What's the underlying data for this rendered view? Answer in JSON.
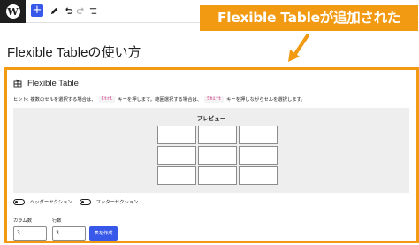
{
  "toolbar": {
    "logo_glyph": "W",
    "add_label": "+",
    "icons": [
      "pen-icon",
      "undo-icon",
      "redo-icon",
      "list-view-icon"
    ]
  },
  "callout": {
    "text": "Flexible Tableが追加された",
    "color": "#f29a12"
  },
  "page": {
    "title": "Flexible Tableの使い方"
  },
  "block": {
    "title": "Flexible Table",
    "hint": {
      "prefix": "ヒント: 複数のセルを選択する場合は、",
      "key1": "Ctrl",
      "middle": "キーを押します。範囲選択する場合は、",
      "key2": "Shift",
      "suffix": "キーを押しながらセルを選択します。"
    },
    "preview": {
      "title": "プレビュー",
      "rows": 3,
      "cols": 3
    },
    "toggles": {
      "header_label": "ヘッダーセクション",
      "footer_label": "フッターセクション"
    },
    "columns": {
      "label": "カラム数",
      "value": "3"
    },
    "rows": {
      "label": "行数",
      "value": "3"
    },
    "create_label": "表を作成"
  },
  "colors": {
    "accent": "#3858e9",
    "highlight": "#f29a12"
  }
}
